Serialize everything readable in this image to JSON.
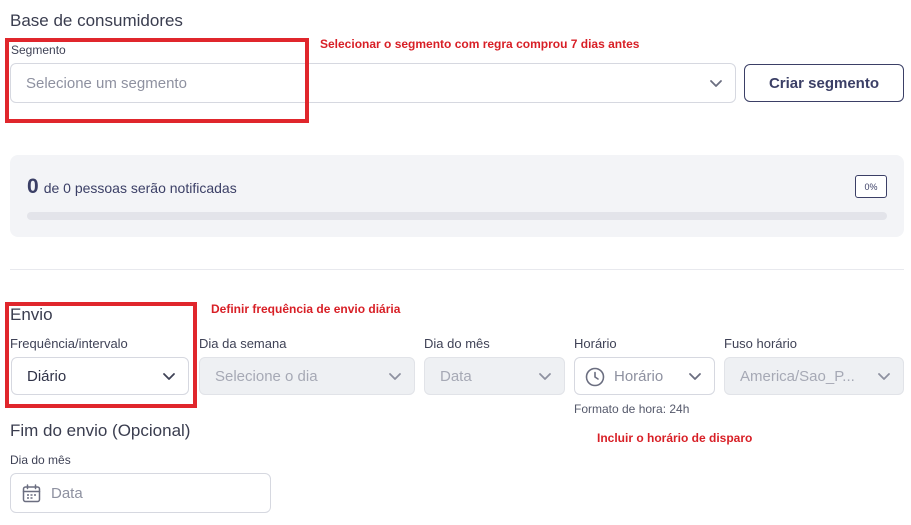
{
  "consumer_base": {
    "title": "Base de consumidores",
    "segment_label": "Segmento",
    "segment_placeholder": "Selecione um segmento",
    "create_segment_button": "Criar segmento",
    "note": "Selecionar o segmento com regra comprou 7 dias antes"
  },
  "notify_summary": {
    "count": "0",
    "text": "de 0 pessoas serão notificadas",
    "percent_label": "0%",
    "progress_fraction": 0
  },
  "envio": {
    "title": "Envio",
    "note": "Definir frequência de envio diária",
    "frequency": {
      "label": "Frequência/intervalo",
      "value": "Diário"
    },
    "weekday": {
      "label": "Dia da semana",
      "placeholder": "Selecione o dia"
    },
    "month_day": {
      "label": "Dia do mês",
      "placeholder": "Data"
    },
    "time": {
      "label": "Horário",
      "placeholder": "Horário",
      "hint": "Formato de hora: 24h"
    },
    "timezone": {
      "label": "Fuso horário",
      "value": "America/Sao_P..."
    },
    "time_note": "Incluir o horário de disparo"
  },
  "end_envio": {
    "title": "Fim do envio (Opcional)",
    "month_day_label": "Dia do mês",
    "date_placeholder": "Data"
  },
  "colors": {
    "accent": "#3b3f66",
    "annotation_red": "#e0262c",
    "card_bg": "#f3f4f7"
  },
  "icons": {
    "chevron": "chevron-down-icon",
    "clock": "clock-icon",
    "calendar": "calendar-icon"
  }
}
